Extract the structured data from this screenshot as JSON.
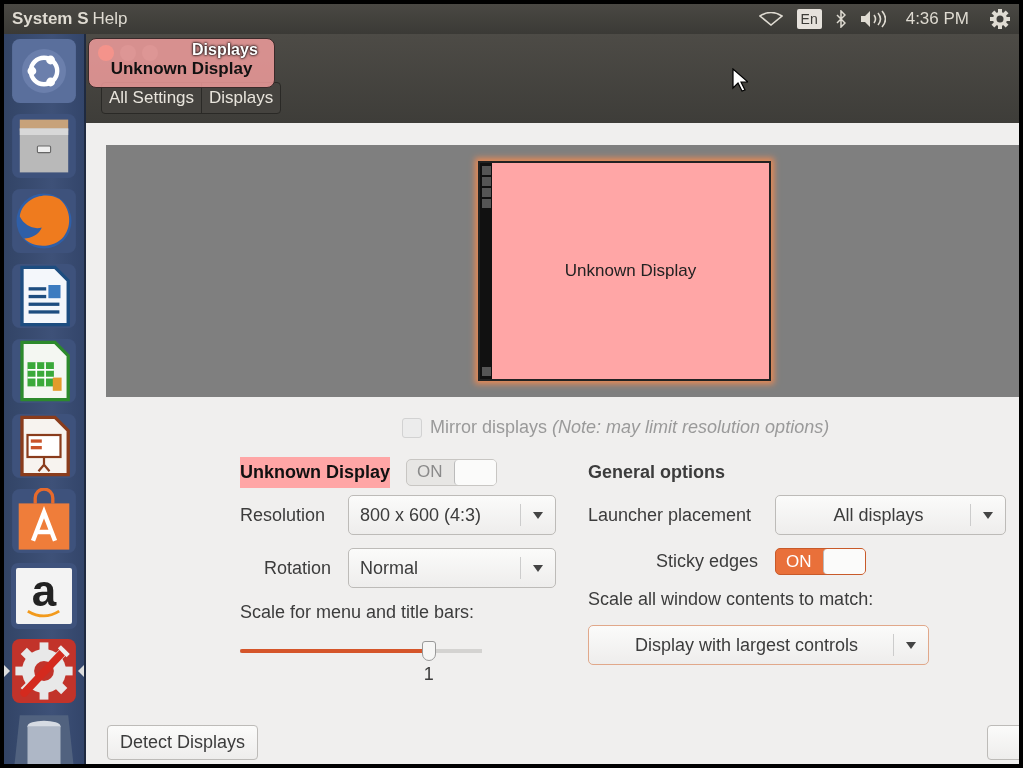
{
  "top_panel": {
    "app_name": "System S",
    "menus": [
      "Help"
    ],
    "keyboard_layout": "En",
    "clock": "4:36 PM"
  },
  "launcher": {
    "items": [
      {
        "kind": "dash",
        "running": false
      },
      {
        "kind": "files",
        "running": false
      },
      {
        "kind": "browser",
        "running": false
      },
      {
        "kind": "writer",
        "running": false
      },
      {
        "kind": "calc",
        "running": false
      },
      {
        "kind": "impress",
        "running": false
      },
      {
        "kind": "store",
        "running": false
      },
      {
        "kind": "letter",
        "label": "a",
        "running": false
      },
      {
        "kind": "settings",
        "running": true
      },
      {
        "kind": "trash",
        "running": false
      }
    ]
  },
  "window": {
    "title": "Displays",
    "tooltip": "Unknown Display",
    "breadcrumb": [
      "All Settings",
      "Displays"
    ]
  },
  "arrangement": {
    "monitors": [
      {
        "label": "Unknown Display"
      }
    ]
  },
  "mirror": {
    "label": "Mirror displays",
    "note": "(Note: may limit resolution options)",
    "checked": false,
    "disabled": true
  },
  "monitor": {
    "name": "Unknown Display",
    "power": {
      "label": "ON",
      "on": true,
      "disabled": true
    },
    "resolution": {
      "label": "Resolution",
      "value": "800 x 600 (4:3)"
    },
    "rotation": {
      "label": "Rotation",
      "value": "Normal"
    },
    "scale": {
      "label": "Scale for menu and title bars:",
      "level": 0.78,
      "reading": "1"
    }
  },
  "general": {
    "title": "General options",
    "launcher_placement": {
      "label": "Launcher placement",
      "value": "All displays"
    },
    "sticky_edges": {
      "label": "Sticky edges",
      "toggle": "ON",
      "on": true,
      "disabled": false
    },
    "scale_contents": {
      "label": "Scale all window contents to match:",
      "value": "Display with largest controls"
    }
  },
  "buttons": [
    {
      "label": "Detect Displays"
    }
  ]
}
